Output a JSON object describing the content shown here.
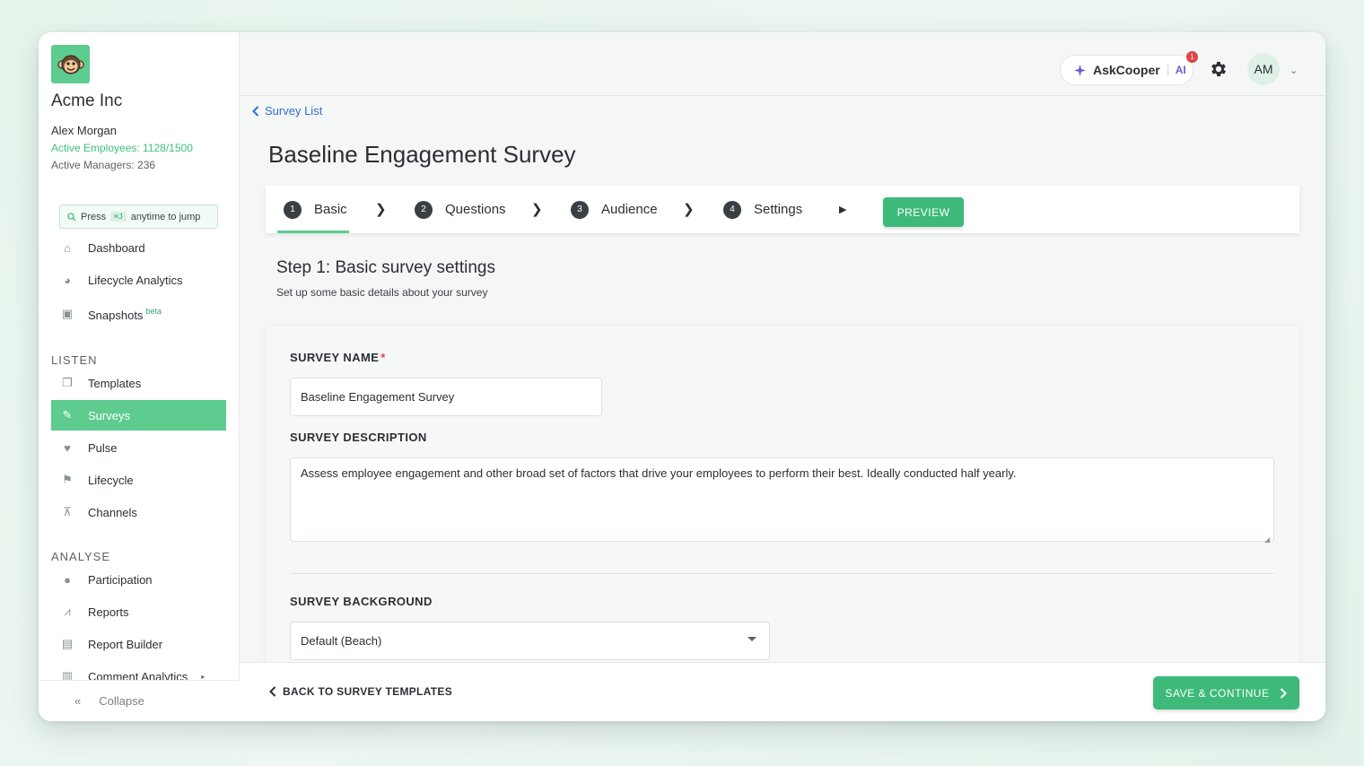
{
  "sidebar": {
    "org_name": "Acme Inc",
    "user_name": "Alex Morgan",
    "active_employees": "Active Employees: 1128/1500",
    "active_managers": "Active Managers: 236",
    "jump": {
      "press": "Press",
      "shortcut": "⌘J",
      "suffix": "anytime to jump"
    },
    "items": [
      {
        "label": "Dashboard",
        "icon": "home-icon"
      },
      {
        "label": "Lifecycle Analytics",
        "icon": "pie-chart-icon"
      },
      {
        "label": "Snapshots",
        "badge": "beta",
        "icon": "camera-icon"
      }
    ],
    "listen_title": "LISTEN",
    "listen_items": [
      {
        "label": "Templates",
        "icon": "copy-icon"
      },
      {
        "label": "Surveys",
        "icon": "brush-icon",
        "active": true
      },
      {
        "label": "Pulse",
        "icon": "heartbeat-icon"
      },
      {
        "label": "Lifecycle",
        "icon": "flag-icon"
      },
      {
        "label": "Channels",
        "icon": "broadcast-icon"
      }
    ],
    "analyse_title": "ANALYSE",
    "analyse_items": [
      {
        "label": "Participation",
        "icon": "user-check-icon"
      },
      {
        "label": "Reports",
        "icon": "line-chart-icon"
      },
      {
        "label": "Report Builder",
        "icon": "file-export-icon"
      },
      {
        "label": "Comment Analytics",
        "icon": "bar-chart-icon"
      }
    ],
    "collapse": "Collapse"
  },
  "topbar": {
    "askcooper": "AskCooper",
    "ai": "AI",
    "notification_count": "1",
    "avatar": "AM"
  },
  "breadcrumb": "Survey List",
  "page_title": "Baseline Engagement Survey",
  "steps": [
    {
      "num": "1",
      "label": "Basic",
      "active": true
    },
    {
      "num": "2",
      "label": "Questions"
    },
    {
      "num": "3",
      "label": "Audience"
    },
    {
      "num": "4",
      "label": "Settings"
    }
  ],
  "preview_label": "PREVIEW",
  "step_title": "Step 1: Basic survey settings",
  "step_subtitle": "Set up some basic details about your survey",
  "form": {
    "name_label": "SURVEY NAME",
    "required_mark": "*",
    "name_value": "Baseline Engagement Survey",
    "description_label": "SURVEY DESCRIPTION",
    "description_value": "Assess employee engagement and other broad set of factors that drive your employees to perform their best. Ideally conducted half yearly.",
    "background_label": "SURVEY BACKGROUND",
    "background_value": "Default (Beach)"
  },
  "footer": {
    "back_label": "BACK TO SURVEY TEMPLATES",
    "save_label": "SAVE & CONTINUE"
  },
  "colors": {
    "accent": "#5dcc8e",
    "button": "#3dba7a",
    "link": "#2f6fd6",
    "required": "#e04444"
  }
}
